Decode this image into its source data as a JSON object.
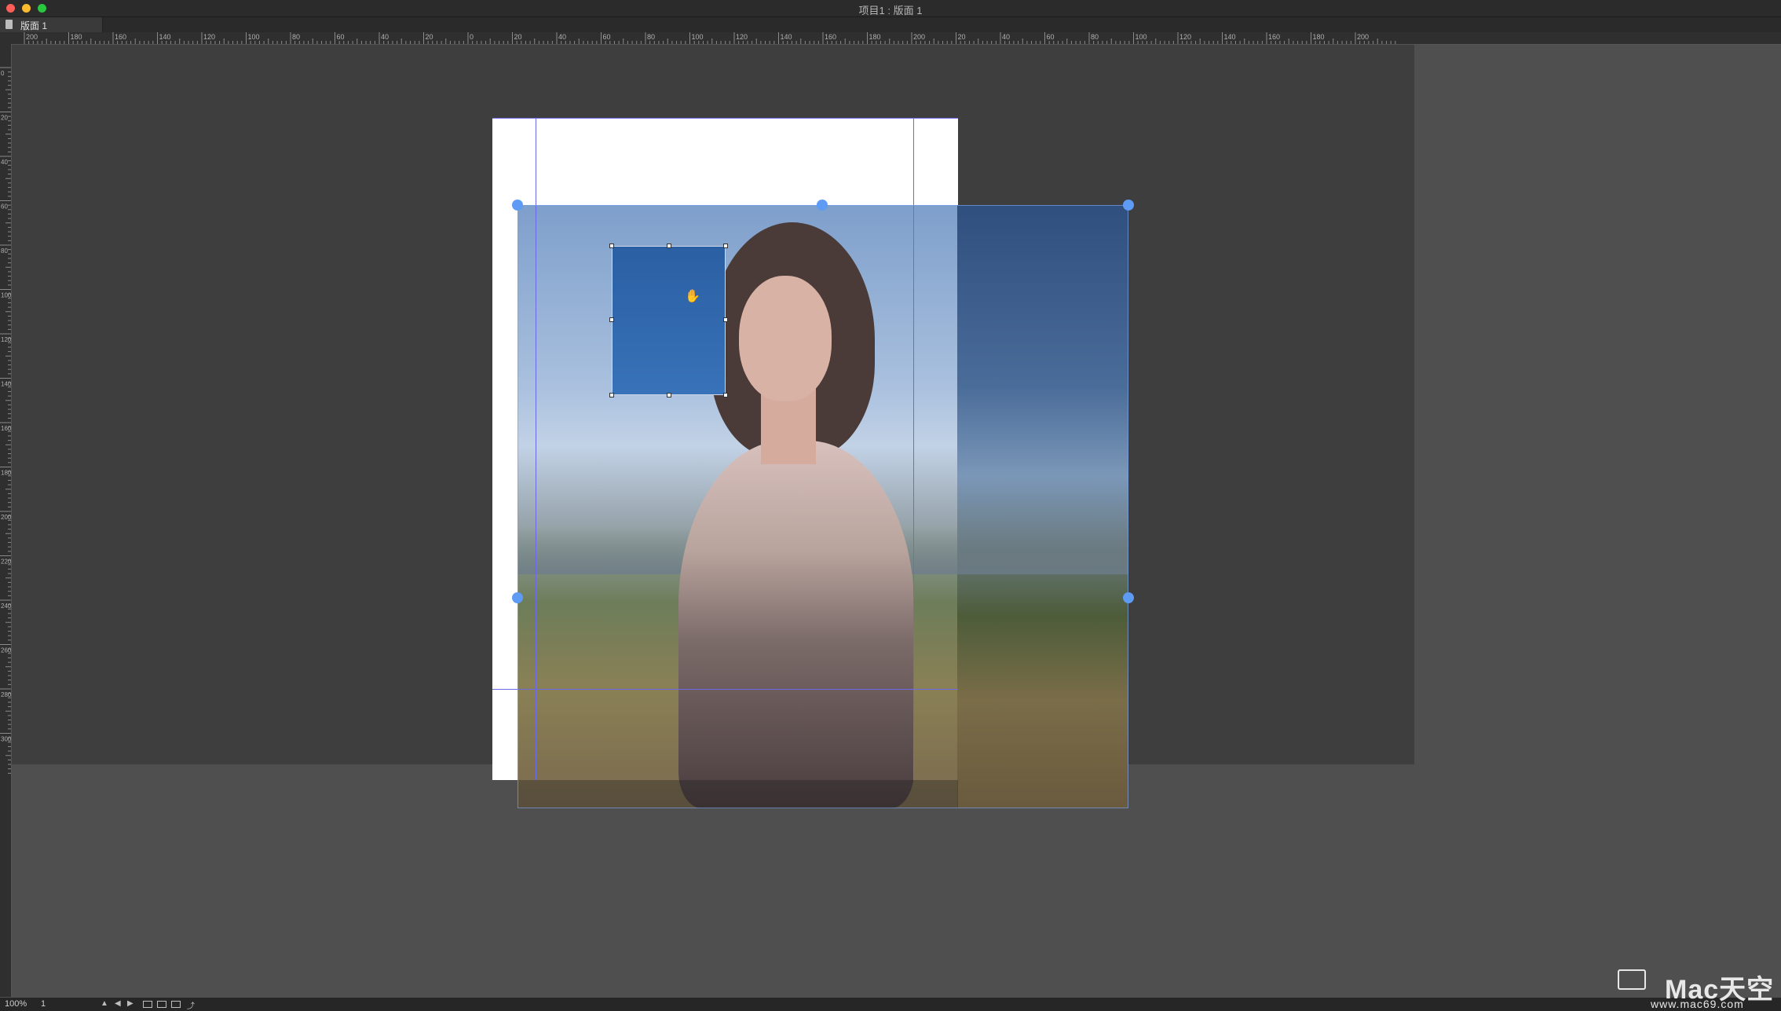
{
  "window": {
    "title": "项目1 : 版面 1"
  },
  "tabs": [
    {
      "label": "版面 1"
    }
  ],
  "ruler": {
    "top_labels": [
      "200",
      "180",
      "160",
      "140",
      "120",
      "100",
      "80",
      "60",
      "40",
      "20",
      "0",
      "20",
      "40",
      "60",
      "80",
      "100",
      "120",
      "140",
      "160",
      "180",
      "200",
      "20",
      "40",
      "60",
      "80",
      "100",
      "120",
      "140",
      "160",
      "180",
      "200"
    ],
    "left_labels": [
      "0",
      "20",
      "40",
      "60",
      "80",
      "100",
      "120",
      "140",
      "160",
      "180",
      "200",
      "220",
      "240",
      "260",
      "280",
      "300"
    ]
  },
  "statusbar": {
    "zoom": "100%",
    "page": "1"
  },
  "watermark": {
    "brand": "Mac天空",
    "url": "www.mac69.com"
  },
  "colors": {
    "selection_handle": "#5d9bf5",
    "guide": "#6a6ae8",
    "pasteboard": "#3e3e3e"
  }
}
